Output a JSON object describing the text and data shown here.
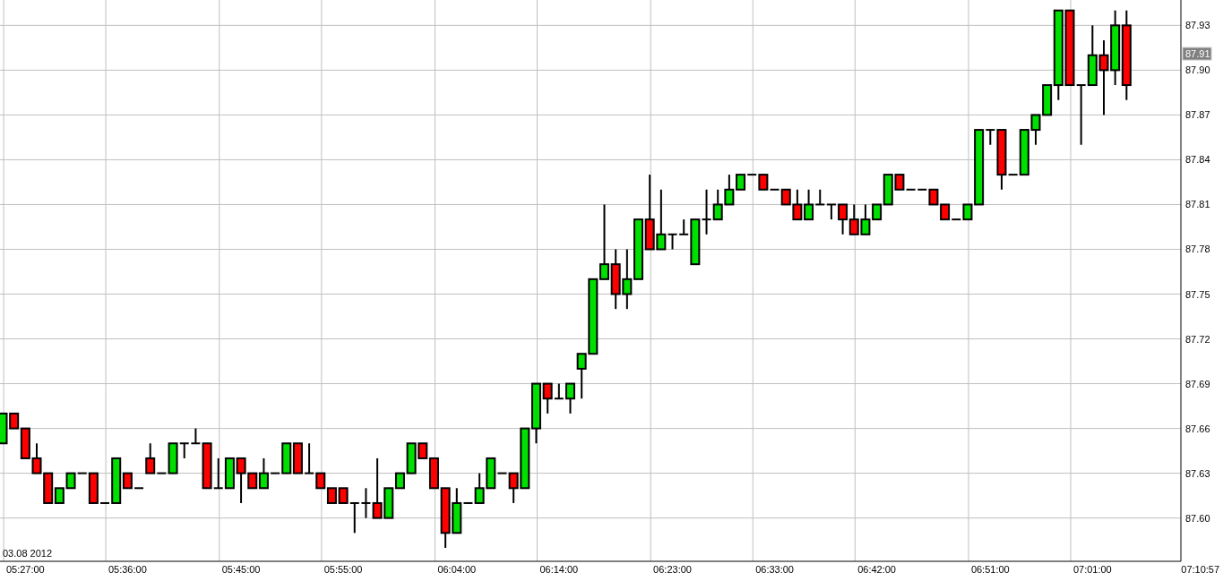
{
  "date_label": "03.08 2012",
  "chart_data": {
    "type": "candlestick",
    "grid": true,
    "categories": [
      null,
      null,
      "05:27:00",
      null,
      null,
      null,
      null,
      null,
      null,
      null,
      null,
      "05:36:00",
      null,
      null,
      null,
      null,
      null,
      null,
      null,
      null,
      null,
      "05:45:00",
      null,
      null,
      null,
      null,
      null,
      null,
      null,
      null,
      "05:55:00",
      null,
      null,
      null,
      null,
      null,
      null,
      null,
      null,
      null,
      "06:04:00",
      null,
      null,
      null,
      null,
      null,
      null,
      null,
      null,
      "06:14:00",
      null,
      null,
      null,
      null,
      null,
      null,
      null,
      null,
      null,
      "06:23:00",
      null,
      null,
      null,
      null,
      null,
      null,
      null,
      null,
      "06:33:00",
      null,
      null,
      null,
      null,
      null,
      null,
      null,
      null,
      "06:42:00",
      null,
      null,
      null,
      null,
      null,
      null,
      null,
      null,
      null,
      "06:51:00",
      null,
      null,
      null,
      null,
      null,
      null,
      null,
      null,
      "07:01:00",
      null,
      null,
      null,
      null,
      null,
      null,
      null,
      null,
      null,
      "07:10:57"
    ],
    "ohlc": [
      [
        87.65,
        87.67,
        87.65,
        87.67
      ],
      [
        87.67,
        87.67,
        87.66,
        87.66
      ],
      [
        87.66,
        87.66,
        87.64,
        87.64
      ],
      [
        87.64,
        87.65,
        87.63,
        87.63
      ],
      [
        87.63,
        87.63,
        87.61,
        87.61
      ],
      [
        87.61,
        87.62,
        87.61,
        87.62
      ],
      [
        87.62,
        87.63,
        87.62,
        87.63
      ],
      [
        87.63,
        87.63,
        87.63,
        87.63
      ],
      [
        87.63,
        87.63,
        87.61,
        87.61
      ],
      [
        87.61,
        87.61,
        87.61,
        87.61
      ],
      [
        87.61,
        87.64,
        87.61,
        87.64
      ],
      [
        87.63,
        87.63,
        87.62,
        87.62
      ],
      [
        87.62,
        87.62,
        87.62,
        87.62
      ],
      [
        87.64,
        87.65,
        87.63,
        87.63
      ],
      [
        87.63,
        87.63,
        87.63,
        87.63
      ],
      [
        87.63,
        87.65,
        87.63,
        87.65
      ],
      [
        87.65,
        87.65,
        87.64,
        87.65
      ],
      [
        87.65,
        87.66,
        87.65,
        87.65
      ],
      [
        87.65,
        87.65,
        87.62,
        87.62
      ],
      [
        87.62,
        87.64,
        87.62,
        87.62
      ],
      [
        87.62,
        87.64,
        87.62,
        87.64
      ],
      [
        87.64,
        87.64,
        87.61,
        87.63
      ],
      [
        87.63,
        87.63,
        87.62,
        87.62
      ],
      [
        87.62,
        87.64,
        87.62,
        87.63
      ],
      [
        87.63,
        87.63,
        87.63,
        87.63
      ],
      [
        87.63,
        87.65,
        87.63,
        87.65
      ],
      [
        87.65,
        87.65,
        87.63,
        87.63
      ],
      [
        87.63,
        87.65,
        87.63,
        87.63
      ],
      [
        87.63,
        87.63,
        87.62,
        87.62
      ],
      [
        87.62,
        87.62,
        87.61,
        87.61
      ],
      [
        87.62,
        87.62,
        87.61,
        87.61
      ],
      [
        87.61,
        87.61,
        87.59,
        87.61
      ],
      [
        87.61,
        87.62,
        87.6,
        87.61
      ],
      [
        87.61,
        87.64,
        87.6,
        87.6
      ],
      [
        87.6,
        87.62,
        87.6,
        87.62
      ],
      [
        87.62,
        87.63,
        87.62,
        87.63
      ],
      [
        87.63,
        87.65,
        87.63,
        87.65
      ],
      [
        87.65,
        87.65,
        87.64,
        87.64
      ],
      [
        87.64,
        87.64,
        87.62,
        87.62
      ],
      [
        87.62,
        87.62,
        87.58,
        87.59
      ],
      [
        87.59,
        87.62,
        87.59,
        87.61
      ],
      [
        87.61,
        87.61,
        87.61,
        87.61
      ],
      [
        87.61,
        87.63,
        87.61,
        87.62
      ],
      [
        87.62,
        87.64,
        87.62,
        87.64
      ],
      [
        87.63,
        87.63,
        87.63,
        87.63
      ],
      [
        87.63,
        87.63,
        87.61,
        87.62
      ],
      [
        87.62,
        87.66,
        87.62,
        87.66
      ],
      [
        87.66,
        87.69,
        87.65,
        87.69
      ],
      [
        87.69,
        87.69,
        87.67,
        87.68
      ],
      [
        87.68,
        87.69,
        87.68,
        87.68
      ],
      [
        87.68,
        87.69,
        87.67,
        87.69
      ],
      [
        87.7,
        87.71,
        87.68,
        87.71
      ],
      [
        87.71,
        87.76,
        87.71,
        87.76
      ],
      [
        87.76,
        87.81,
        87.76,
        87.77
      ],
      [
        87.77,
        87.78,
        87.74,
        87.75
      ],
      [
        87.75,
        87.78,
        87.74,
        87.76
      ],
      [
        87.76,
        87.8,
        87.76,
        87.8
      ],
      [
        87.8,
        87.83,
        87.78,
        87.78
      ],
      [
        87.78,
        87.82,
        87.78,
        87.79
      ],
      [
        87.79,
        87.79,
        87.78,
        87.79
      ],
      [
        87.79,
        87.8,
        87.79,
        87.79
      ],
      [
        87.77,
        87.8,
        87.77,
        87.8
      ],
      [
        87.8,
        87.82,
        87.79,
        87.8
      ],
      [
        87.8,
        87.82,
        87.8,
        87.81
      ],
      [
        87.81,
        87.83,
        87.81,
        87.82
      ],
      [
        87.82,
        87.83,
        87.82,
        87.83
      ],
      [
        87.83,
        87.83,
        87.83,
        87.83
      ],
      [
        87.83,
        87.83,
        87.82,
        87.82
      ],
      [
        87.82,
        87.82,
        87.82,
        87.82
      ],
      [
        87.82,
        87.82,
        87.81,
        87.81
      ],
      [
        87.81,
        87.82,
        87.8,
        87.8
      ],
      [
        87.8,
        87.82,
        87.8,
        87.81
      ],
      [
        87.81,
        87.82,
        87.81,
        87.81
      ],
      [
        87.81,
        87.81,
        87.8,
        87.81
      ],
      [
        87.81,
        87.81,
        87.79,
        87.8
      ],
      [
        87.8,
        87.81,
        87.79,
        87.79
      ],
      [
        87.79,
        87.81,
        87.79,
        87.8
      ],
      [
        87.8,
        87.81,
        87.8,
        87.81
      ],
      [
        87.81,
        87.83,
        87.81,
        87.83
      ],
      [
        87.83,
        87.83,
        87.82,
        87.82
      ],
      [
        87.82,
        87.82,
        87.82,
        87.82
      ],
      [
        87.82,
        87.82,
        87.82,
        87.82
      ],
      [
        87.82,
        87.82,
        87.81,
        87.81
      ],
      [
        87.81,
        87.81,
        87.8,
        87.8
      ],
      [
        87.8,
        87.8,
        87.8,
        87.8
      ],
      [
        87.8,
        87.81,
        87.8,
        87.81
      ],
      [
        87.81,
        87.86,
        87.81,
        87.86
      ],
      [
        87.86,
        87.86,
        87.85,
        87.86
      ],
      [
        87.86,
        87.86,
        87.82,
        87.83
      ],
      [
        87.83,
        87.83,
        87.83,
        87.83
      ],
      [
        87.83,
        87.86,
        87.83,
        87.86
      ],
      [
        87.86,
        87.87,
        87.85,
        87.87
      ],
      [
        87.87,
        87.89,
        87.87,
        87.89
      ],
      [
        87.89,
        87.94,
        87.88,
        87.94
      ],
      [
        87.94,
        87.94,
        87.89,
        87.89
      ],
      [
        87.89,
        87.89,
        87.85,
        87.89
      ],
      [
        87.89,
        87.93,
        87.89,
        87.91
      ],
      [
        87.91,
        87.92,
        87.87,
        87.9
      ],
      [
        87.9,
        87.94,
        87.89,
        87.93
      ],
      [
        87.93,
        87.94,
        87.88,
        87.89
      ],
      null,
      null,
      null,
      null,
      null,
      null,
      null
    ],
    "ylim": [
      87.571,
      87.947
    ],
    "yticks": [
      {
        "value": 87.93,
        "label": "87.93"
      },
      {
        "value": 87.9,
        "label": "87.90"
      },
      {
        "value": 87.87,
        "label": "87.87"
      },
      {
        "value": 87.84,
        "label": "87.84"
      },
      {
        "value": 87.81,
        "label": "87.81"
      },
      {
        "value": 87.78,
        "label": "87.78"
      },
      {
        "value": 87.75,
        "label": "87.75"
      },
      {
        "value": 87.72,
        "label": "87.72"
      },
      {
        "value": 87.69,
        "label": "87.69"
      },
      {
        "value": 87.66,
        "label": "87.66"
      },
      {
        "value": 87.63,
        "label": "87.63"
      },
      {
        "value": 87.6,
        "label": "87.60"
      }
    ],
    "annotations": [
      {
        "y": 87.911,
        "text": "87.91"
      }
    ]
  }
}
